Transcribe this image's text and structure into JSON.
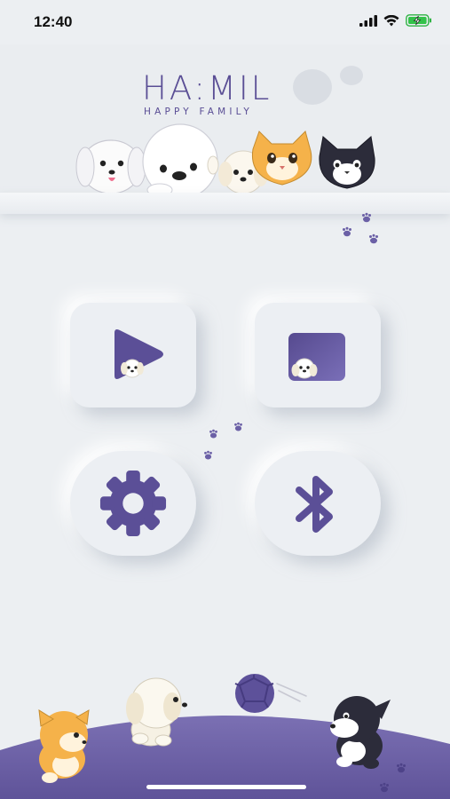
{
  "status_bar": {
    "time": "12:40",
    "icons": [
      "cellular-signal-icon",
      "wifi-icon",
      "battery-charging-icon"
    ]
  },
  "header": {
    "logo_title": "HA:MIL",
    "logo_subtitle": "HAPPY FAMILY"
  },
  "menu": {
    "tiles": [
      {
        "name": "video-play-button",
        "icon": "play-icon"
      },
      {
        "name": "gallery-button",
        "icon": "photo-frame-icon"
      },
      {
        "name": "settings-button",
        "icon": "gear-icon"
      },
      {
        "name": "bluetooth-button",
        "icon": "bluetooth-icon"
      }
    ]
  },
  "colors": {
    "accent": "#5b4f97",
    "background": "#eceff2",
    "ground": "#6e62a6"
  }
}
